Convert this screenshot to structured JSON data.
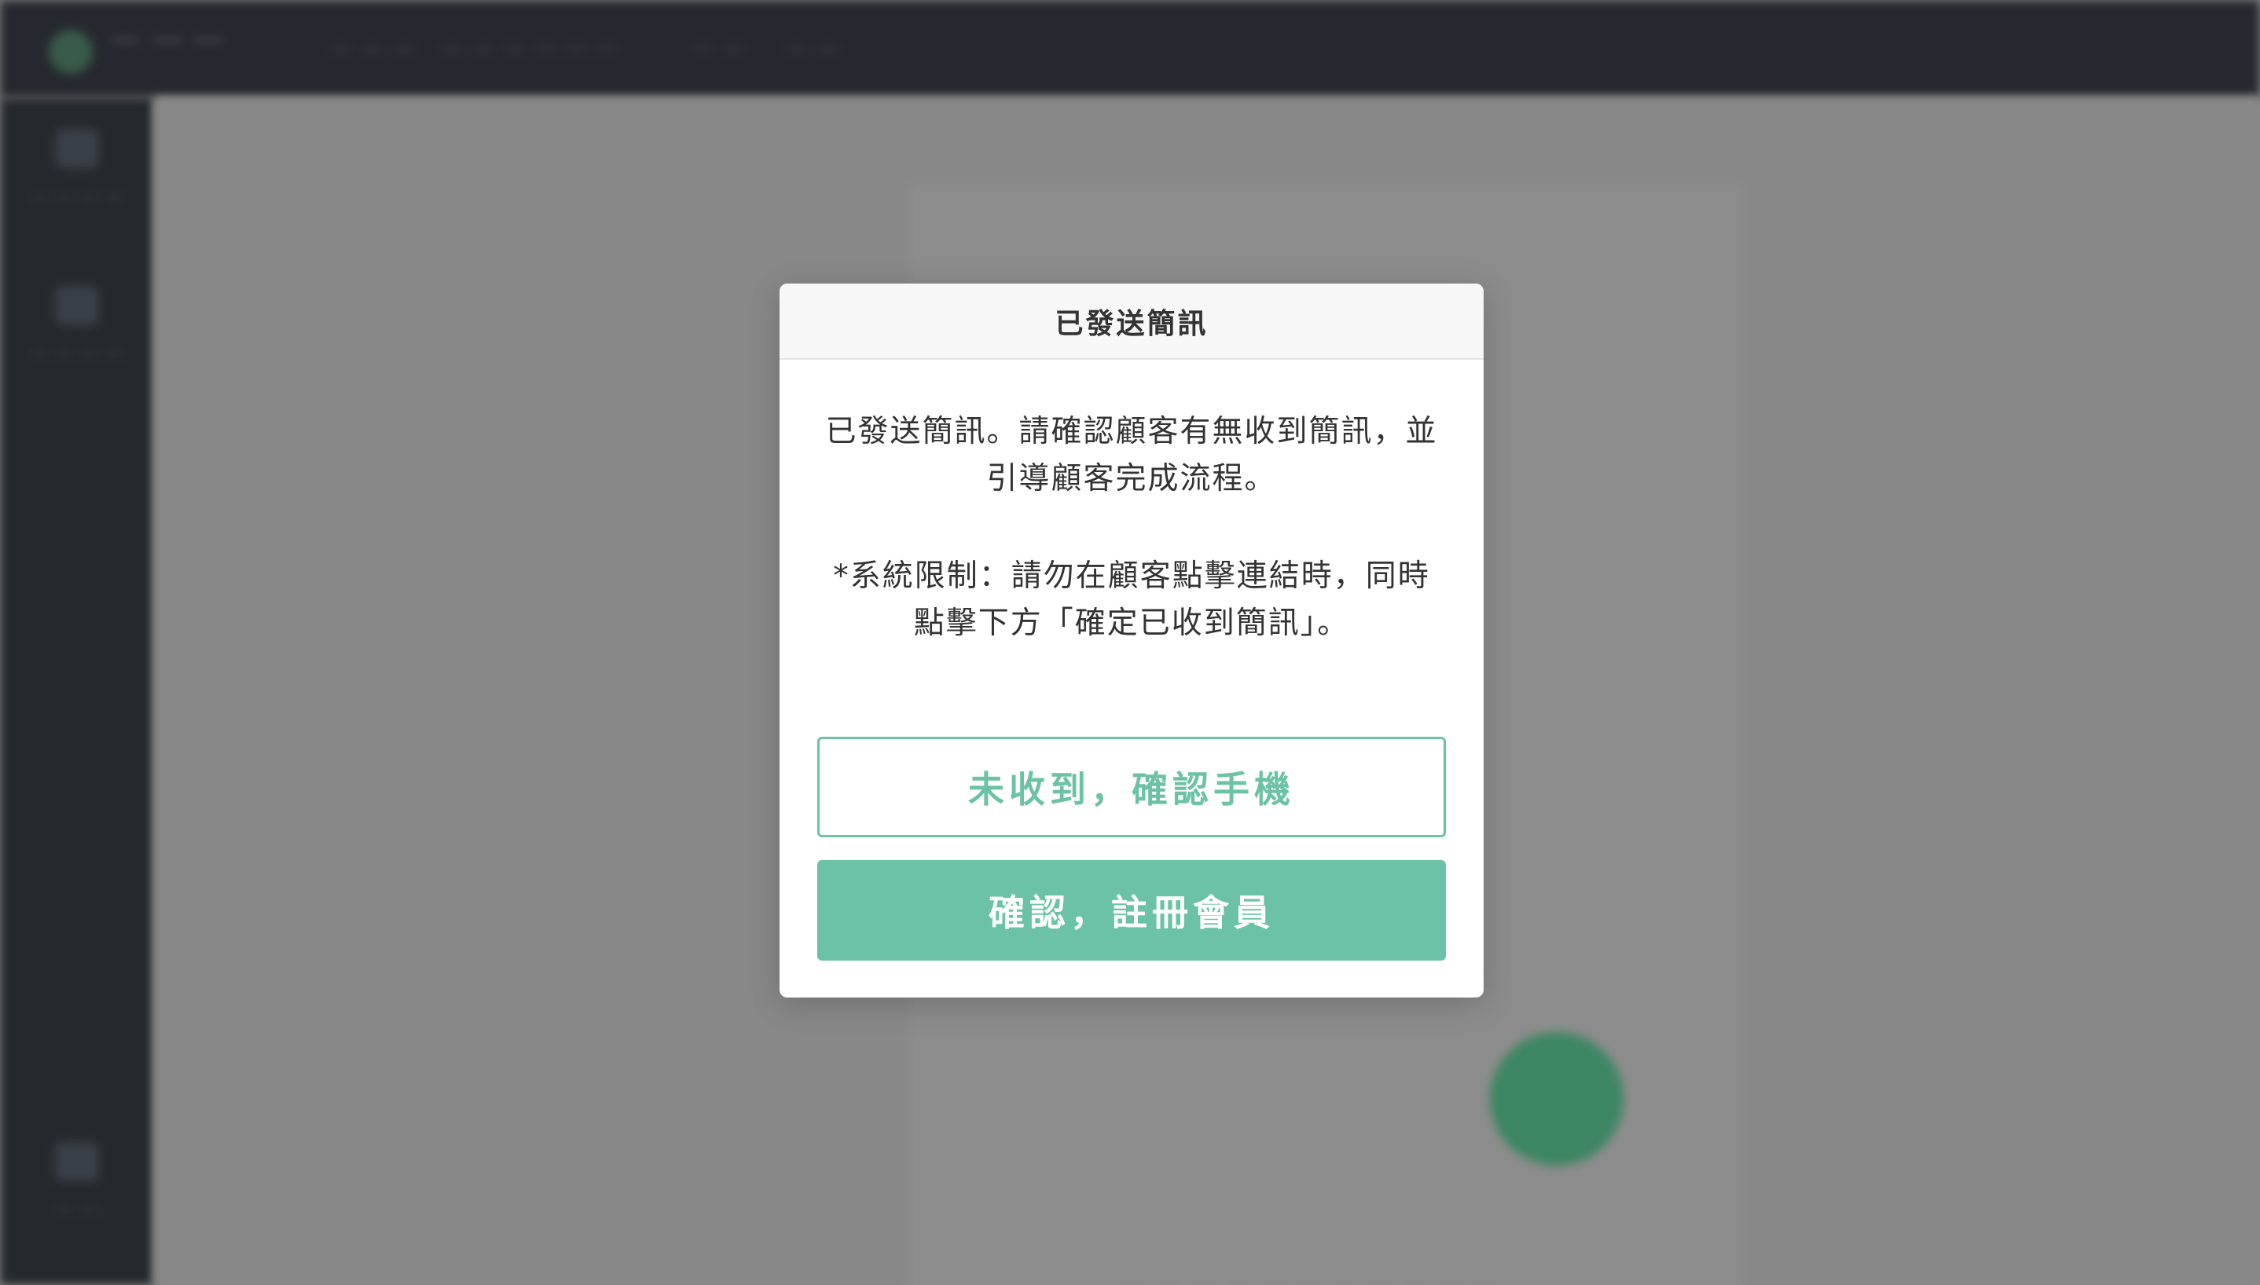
{
  "background": {
    "nav": [
      "— — —",
      "— — — — — —",
      "— —",
      "— —"
    ],
    "sidebar": [
      "— — — —",
      "— — — —",
      "— —"
    ],
    "tabs": "— —   — — — — —",
    "link": "— — — — —   — — — — — —"
  },
  "modal": {
    "title": "已發送簡訊",
    "message_line1": "已發送簡訊。請確認顧客有無收到簡訊，並引導顧客完成流程。",
    "message_line2": "*系統限制：請勿在顧客點擊連結時，同時點擊下方「確定已收到簡訊」。",
    "secondary_button": "未收到，確認手機",
    "primary_button": "確認，註冊會員"
  },
  "colors": {
    "accent": "#6cc2a6",
    "topbar": "#262a30",
    "sidebar": "#252a2f"
  }
}
